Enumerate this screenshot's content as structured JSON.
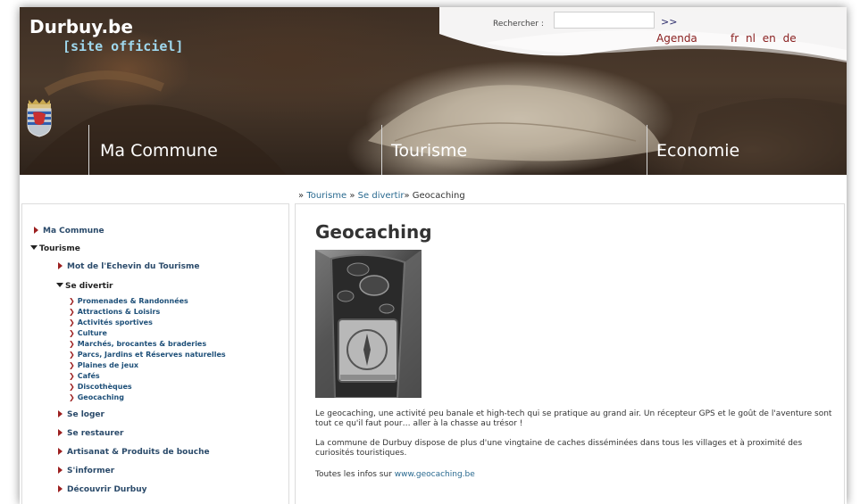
{
  "header": {
    "site_name": "Durbuy.be",
    "site_subtitle": "[site officiel]",
    "search_label": "Rechercher :",
    "search_value": "",
    "search_go": ">>",
    "agenda": "Agenda",
    "languages": [
      "fr",
      "nl",
      "en",
      "de"
    ],
    "nav": [
      "Ma Commune",
      "Tourisme",
      "Economie"
    ]
  },
  "breadcrumb": {
    "sep": "»",
    "items": [
      "Tourisme",
      "Se divertir",
      "Geocaching"
    ]
  },
  "sidebar": {
    "ma_commune": "Ma Commune",
    "tourisme": "Tourisme",
    "mot_echevin": "Mot de l'Echevin du Tourisme",
    "se_divertir": "Se divertir",
    "divertir_items": [
      "Promenades & Randonnées",
      "Attractions & Loisirs",
      "Activités sportives",
      "Culture",
      "Marchés, brocantes & braderies",
      "Parcs, Jardins et Réserves naturelles",
      "Plaines de jeux",
      "Cafés",
      "Discothèques",
      "Geocaching"
    ],
    "se_loger": "Se loger",
    "se_restaurer": "Se restaurer",
    "artisanat": "Artisanat & Produits de bouche",
    "informer": "S'informer",
    "decouvrir": "Découvrir Durbuy"
  },
  "content": {
    "title": "Geocaching",
    "para1": "Le geocaching, une activité peu banale et high-tech qui se pratique au grand air. Un récepteur GPS et le goût de l'aventure sont tout ce qu'il faut pour… aller à la chasse au trésor !",
    "para2": "La commune de Durbuy dispose de plus d'une vingtaine de caches disséminées dans tous les villages et à proximité des curiosités touristiques.",
    "para3_prefix": "Toutes les infos sur ",
    "para3_link": "www.geocaching.be"
  },
  "colors": {
    "link": "#2a6a90",
    "side_text": "#2a4a6a",
    "arrow": "#9c2020"
  },
  "icons": {
    "crest": "durbuy-crest-icon",
    "collapsed": "triangle-right-icon",
    "expanded": "triangle-down-icon",
    "leaf": "chevron-right-icon"
  }
}
